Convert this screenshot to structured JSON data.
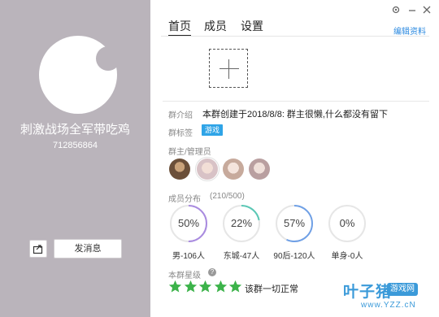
{
  "profile": {
    "group_name": "刺激战场全军带吃鸡",
    "group_id": "712856864"
  },
  "left_actions": {
    "share_icon": "share-icon",
    "send_message_label": "发消息"
  },
  "titlebar": {
    "settings_icon": "settings-icon",
    "minimize_icon": "minimize-icon",
    "close_icon": "close-icon"
  },
  "tabs": [
    {
      "label": "首页",
      "active": true
    },
    {
      "label": "成员",
      "active": false
    },
    {
      "label": "设置",
      "active": false
    }
  ],
  "edit_link": "编辑资料",
  "info": {
    "intro_label": "群介绍",
    "intro_text": "本群创建于2018/8/8:  群主很懒,什么都没有留下",
    "tag_label": "群标签",
    "tag_value": "游戏",
    "admin_label": "群主/管理员"
  },
  "distribution": {
    "label": "成员分布",
    "count": "(210/500)",
    "items": [
      {
        "percent": "50%",
        "caption": "男-106人",
        "color": "#a98be0",
        "fraction": 0.5
      },
      {
        "percent": "22%",
        "caption": "东城-47人",
        "color": "#5bc8b6",
        "fraction": 0.22
      },
      {
        "percent": "57%",
        "caption": "90后-120人",
        "color": "#6fa0e6",
        "fraction": 0.57
      },
      {
        "percent": "0%",
        "caption": "单身-0人",
        "color": "#cccccc",
        "fraction": 0.0
      }
    ]
  },
  "level": {
    "label": "本群星级",
    "stars": 5,
    "text": "该群一切正常"
  },
  "watermark": {
    "main": "叶子猪",
    "badge": "游戏网",
    "url": "www.YZZ.cN"
  },
  "colors": {
    "accent": "#2c8ae0",
    "tag_bg": "#2fa4e7",
    "star": "#3cb34a",
    "left_panel": "#bab4bb"
  }
}
